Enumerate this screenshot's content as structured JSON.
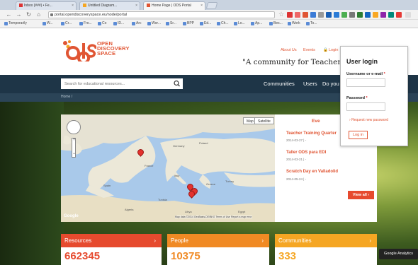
{
  "browser": {
    "tabs": [
      {
        "label": "Inbox (###) • Fe..."
      },
      {
        "label": "Untitled Diagram..."
      },
      {
        "label": "Home Page | ODS Portal"
      }
    ],
    "url": "portal.opendiscoveryspace.eu/node/portal",
    "bookmarks": [
      "Temporarily",
      "W...",
      "Cr...",
      "Fro...",
      "Co",
      "ID...",
      "Arc",
      "Wor...",
      "Sr...",
      "BPP",
      "Ed...",
      "Ch...",
      "Lo...",
      "Ap...",
      "Bes...",
      "Work",
      "To..."
    ]
  },
  "header": {
    "logo_mark": "ods",
    "logo_lines": [
      "OPEN",
      "DISCOVERY",
      "SPACE"
    ],
    "links": [
      "About Us",
      "Events"
    ],
    "login_link": "Login",
    "tagline": "\"A community for Teachers by"
  },
  "nav": {
    "search_placeholder": "Search for educational resources...",
    "links": [
      "Communities",
      "Users",
      "Do you"
    ],
    "breadcrumb": "Home /"
  },
  "map": {
    "type_buttons": [
      "Map",
      "Satellite"
    ],
    "labels": [
      "France",
      "Spain",
      "Italy",
      "Greece",
      "Turkey",
      "Algeria",
      "Tunisia",
      "Libya",
      "Egypt",
      "Germany",
      "Poland"
    ],
    "credit": "Map data ©2014 GeoBasis-DE/BKG  Terms of Use  Report a map error",
    "google": "Google"
  },
  "events": {
    "title": "Eve",
    "items": [
      {
        "title": "Teacher Training Quarter",
        "date": "2014-03-27 | -"
      },
      {
        "title": "Taller ODS para EDI",
        "date": "2014-03-21 | -"
      },
      {
        "title": "Scratch Day en Valladolid",
        "date": "2014-05-24 | -"
      }
    ],
    "view_all": "View all ›"
  },
  "login": {
    "title": "User login",
    "username_label": "Username or e-mail",
    "password_label": "Password",
    "required_mark": "*",
    "request_link": "Request new password",
    "button": "Log in"
  },
  "stats": [
    {
      "label": "Resources",
      "value": "662345",
      "color": "#e64a2e"
    },
    {
      "label": "People",
      "value": "10375",
      "color": "#f08a24"
    },
    {
      "label": "Communities",
      "value": "333",
      "color": "#f5a623"
    }
  ],
  "ga_badge": "Google Analytics",
  "colors": {
    "accent": "#e05533",
    "navbar": "#1e3547"
  }
}
